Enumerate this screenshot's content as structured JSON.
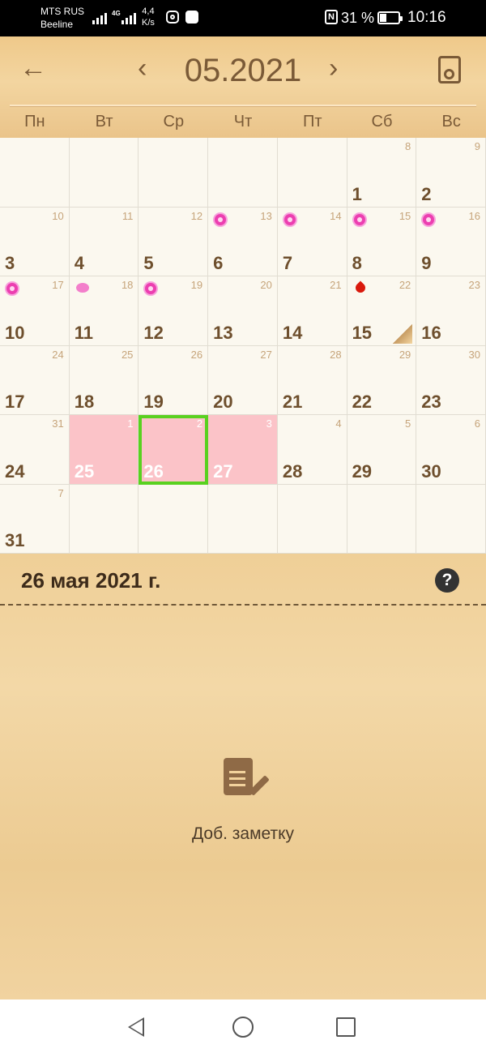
{
  "status_bar": {
    "carrier1": "MTS RUS",
    "carrier2": "Beeline",
    "network": "4G",
    "speed_value": "4,4",
    "speed_unit": "K/s",
    "battery_pct": "31 %",
    "time": "10:16"
  },
  "header": {
    "month_title": "05.2021",
    "weekdays": [
      "Пн",
      "Вт",
      "Ср",
      "Чт",
      "Пт",
      "Сб",
      "Вс"
    ]
  },
  "calendar": {
    "cells": [
      {
        "day": "",
        "week": ""
      },
      {
        "day": "",
        "week": ""
      },
      {
        "day": "",
        "week": ""
      },
      {
        "day": "",
        "week": ""
      },
      {
        "day": "",
        "week": ""
      },
      {
        "day": "1",
        "week": "8"
      },
      {
        "day": "2",
        "week": "9"
      },
      {
        "day": "3",
        "week": "10"
      },
      {
        "day": "4",
        "week": "11"
      },
      {
        "day": "5",
        "week": "12"
      },
      {
        "day": "6",
        "week": "13",
        "marker": "flower"
      },
      {
        "day": "7",
        "week": "14",
        "marker": "flower"
      },
      {
        "day": "8",
        "week": "15",
        "marker": "flower"
      },
      {
        "day": "9",
        "week": "16",
        "marker": "flower"
      },
      {
        "day": "10",
        "week": "17",
        "marker": "flower"
      },
      {
        "day": "11",
        "week": "18",
        "marker": "egg"
      },
      {
        "day": "12",
        "week": "19",
        "marker": "flower"
      },
      {
        "day": "13",
        "week": "20"
      },
      {
        "day": "14",
        "week": "21"
      },
      {
        "day": "15",
        "week": "22",
        "marker": "drop",
        "note": true
      },
      {
        "day": "16",
        "week": "23"
      },
      {
        "day": "17",
        "week": "24"
      },
      {
        "day": "18",
        "week": "25"
      },
      {
        "day": "19",
        "week": "26"
      },
      {
        "day": "20",
        "week": "27"
      },
      {
        "day": "21",
        "week": "28"
      },
      {
        "day": "22",
        "week": "29"
      },
      {
        "day": "23",
        "week": "30"
      },
      {
        "day": "24",
        "week": "31"
      },
      {
        "day": "25",
        "week": "1",
        "pink": true
      },
      {
        "day": "26",
        "week": "2",
        "pink": true,
        "selected": true
      },
      {
        "day": "27",
        "week": "3",
        "pink": true
      },
      {
        "day": "28",
        "week": "4"
      },
      {
        "day": "29",
        "week": "5"
      },
      {
        "day": "30",
        "week": "6"
      },
      {
        "day": "31",
        "week": "7"
      },
      {
        "day": "",
        "week": ""
      },
      {
        "day": "",
        "week": ""
      },
      {
        "day": "",
        "week": ""
      },
      {
        "day": "",
        "week": ""
      },
      {
        "day": "",
        "week": ""
      },
      {
        "day": "",
        "week": ""
      }
    ]
  },
  "panel": {
    "selected_date": "26 мая 2021 г.",
    "help": "?",
    "add_note_label": "Доб. заметку"
  },
  "colors": {
    "period_fill": "#fbc3c8",
    "selection_border": "#59d11f",
    "text_brown": "#6e4f2d"
  }
}
